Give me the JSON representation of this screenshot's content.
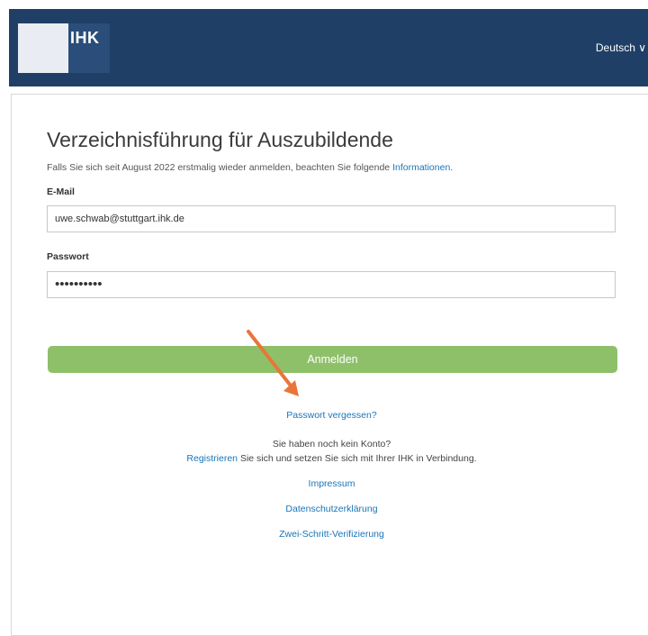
{
  "header": {
    "logo_text": "IHK",
    "language": "Deutsch ∨"
  },
  "page": {
    "title": "Verzeichnisführung für Auszubildende",
    "subtitle": "Falls Sie sich seit August 2022 erstmalig wieder anmelden, beachten Sie folgende",
    "info_link": "Informationen",
    "subtitle_end": "."
  },
  "form": {
    "email_label": "E-Mail",
    "email_value": "uwe.schwab@stuttgart.ihk.de",
    "password_label": "Passwort",
    "password_value": "••••••••••",
    "login_label": "Anmelden"
  },
  "links": {
    "forgot": "Passwort vergessen?",
    "no_account": "Sie haben noch kein Konto?",
    "register": "Registrieren",
    "register_tail": "Sie sich und setzen Sie sich mit Ihrer IHK in Verbindung.",
    "impressum": "Impressum",
    "privacy": "Datenschutzerklärung",
    "two_step": "Zwei-Schritt-Verifizierung"
  },
  "colors": {
    "header_bg": "#1f3f66",
    "button_bg": "#8ec06a",
    "link": "#1a75b8",
    "annotation_arrow": "#e8763a"
  },
  "icons": {
    "annotation": "arrow-annotation-icon"
  }
}
